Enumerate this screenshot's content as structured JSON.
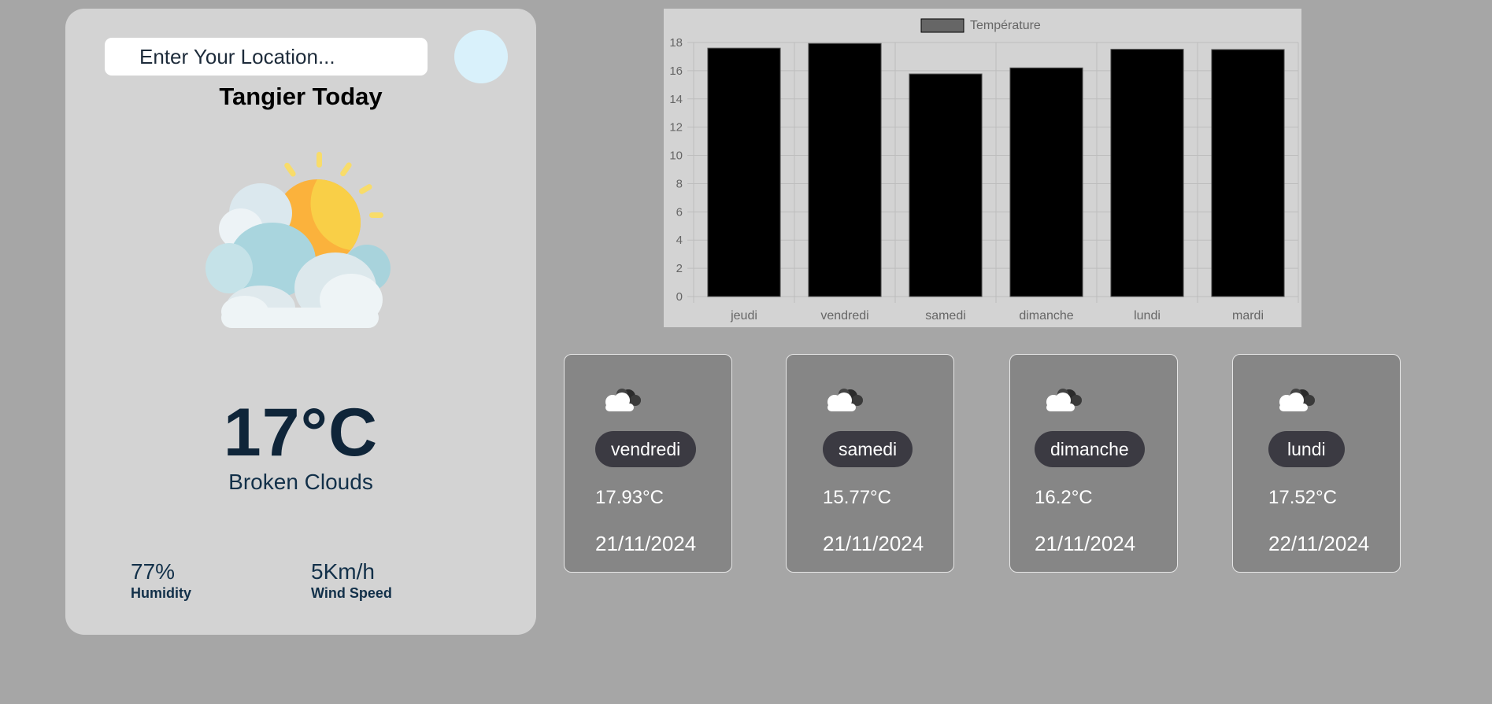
{
  "search": {
    "placeholder": "Enter Your Location..."
  },
  "current": {
    "title": "Tangier Today",
    "temperature": "17°C",
    "description": "Broken Clouds",
    "humidity_value": "77%",
    "humidity_label": "Humidity",
    "wind_value": "5Km/h",
    "wind_label": "Wind Speed"
  },
  "chart_data": {
    "type": "bar",
    "title": "",
    "legend": "Température",
    "legend_position": "top",
    "categories": [
      "jeudi",
      "vendredi",
      "samedi",
      "dimanche",
      "lundi",
      "mardi"
    ],
    "series": [
      {
        "name": "Température",
        "values": [
          17.6,
          17.93,
          15.77,
          16.2,
          17.52,
          17.5
        ]
      }
    ],
    "ylim": [
      0,
      18
    ],
    "yticks": [
      0,
      2,
      4,
      6,
      8,
      10,
      12,
      14,
      16,
      18
    ],
    "grid": true,
    "bar_color": "#000000",
    "legend_color": "#666666"
  },
  "forecast": [
    {
      "day": "vendredi",
      "temp": "17.93°C",
      "date": "21/11/2024"
    },
    {
      "day": "samedi",
      "temp": "15.77°C",
      "date": "21/11/2024"
    },
    {
      "day": "dimanche",
      "temp": "16.2°C",
      "date": "21/11/2024"
    },
    {
      "day": "lundi",
      "temp": "17.52°C",
      "date": "22/11/2024"
    }
  ],
  "icons": {
    "search": "search-icon",
    "weather": "sun-behind-clouds-icon",
    "forecast": "cloud-icon"
  },
  "colors": {
    "page_bg": "#a6a6a6",
    "card_bg": "#d3d3d3",
    "text_dark": "#0f2539",
    "pill_bg": "#3b3a42",
    "forecast_bg": "#868686"
  }
}
